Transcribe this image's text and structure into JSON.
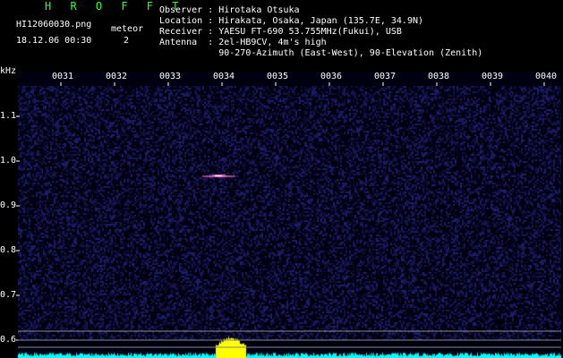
{
  "header": {
    "app_title": "H R O F F T",
    "filename": "HI12060030.png",
    "meteor_label": "meteor",
    "timestamp": "18.12.06 00:30",
    "meteor_count": "2",
    "observer": "Observer : Hirotaka Otsuka",
    "location": "Location : Hirakata, Osaka, Japan (135.7E, 34.9N)",
    "receiver": "Receiver : YAESU FT-690 53.755MHz(Fukui), USB",
    "antenna": "Antenna  : 2el-HB9CV, 4m's high",
    "antenna2": "           90-270-Azimuth (East-West), 90-Elevation (Zenith)"
  },
  "plot": {
    "y_unit": "kHz",
    "y_ticks": [
      "1.1",
      "1.0",
      "0.9",
      "0.8",
      "0.7",
      "0.6"
    ],
    "y_values": [
      1.1,
      1.0,
      0.9,
      0.8,
      0.7,
      0.6
    ],
    "x_ticks": [
      "0031",
      "0032",
      "0033",
      "0034",
      "0035",
      "0036",
      "0037",
      "0038",
      "0039",
      "0040"
    ],
    "meteor_trace": {
      "time": "0034",
      "freq_khz": 0.97
    },
    "colors": {
      "background": "#000010",
      "noise": "#2a2aa0",
      "meteor_echo": "#ff66cc",
      "signal_level": "#00ffff",
      "signal_peak": "#ffff00",
      "gridline": "#888888"
    }
  }
}
